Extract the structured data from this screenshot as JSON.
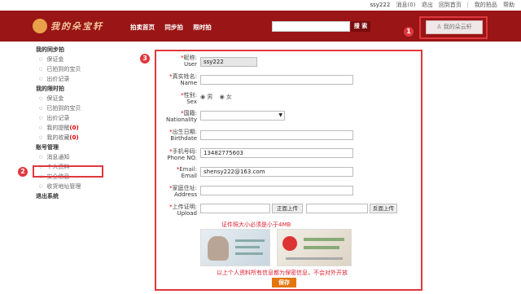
{
  "topbar": {
    "user": "ssy222",
    "links": [
      "消息(0)",
      "退出",
      "回到首页",
      "我的拍品",
      "帮助"
    ]
  },
  "header": {
    "logo_text": "我的朵宝轩",
    "nav": [
      "拍卖首页",
      "同步拍",
      "限时拍"
    ],
    "search_placeholder": "",
    "search_button": "搜 索",
    "cloud_button": "我的朵云轩"
  },
  "badges": [
    "1",
    "2",
    "3"
  ],
  "sidebar": {
    "sections": [
      {
        "title": "我的同步拍",
        "items": [
          {
            "label": "保证金"
          },
          {
            "label": "已拍到的宝贝"
          },
          {
            "label": "出价记录"
          }
        ]
      },
      {
        "title": "我的限时拍",
        "items": [
          {
            "label": "保证金"
          },
          {
            "label": "已拍到的宝贝"
          },
          {
            "label": "出价记录"
          },
          {
            "label": "我的提醒",
            "count": "(0)"
          },
          {
            "label": "我的收藏",
            "count": "(0)"
          }
        ]
      },
      {
        "title": "账号管理",
        "items": [
          {
            "label": "消息通知"
          },
          {
            "label": "个人资料"
          },
          {
            "label": "安全信息"
          },
          {
            "label": "收货地址管理"
          }
        ]
      },
      {
        "title": "退出系统",
        "items": []
      }
    ]
  },
  "form": {
    "user": {
      "cn": "昵称:",
      "en": "User",
      "value": "ssy222"
    },
    "name": {
      "cn": "真实姓名:",
      "en": "Name",
      "value": ""
    },
    "sex": {
      "cn": "性别:",
      "en": "Sex",
      "options": [
        "男",
        "女"
      ]
    },
    "nationality": {
      "cn": "国籍:",
      "en": "Nationality",
      "value": ""
    },
    "birthdate": {
      "cn": "出生日期:",
      "en": "Birthdate",
      "value": ""
    },
    "phone": {
      "cn": "手机号码:",
      "en": "Phone NO.",
      "value": "13482775603"
    },
    "email": {
      "cn": "Email:",
      "en": "Email",
      "value": "shensy222@163.com"
    },
    "address": {
      "cn": "家庭住址:",
      "en": "Address",
      "value": ""
    },
    "upload": {
      "cn": "上传证明:",
      "en": "Upload",
      "front_button": "正面上传",
      "back_button": "反面上传"
    },
    "size_note": "证件照大小必须是小于4MB",
    "privacy_note": "以上个人资料所有信息都为保密信息，不会对外开放",
    "save_button": "保存"
  },
  "colors": {
    "header": "#9a1515",
    "highlight": "#e0383e",
    "save": "#e5760f"
  }
}
